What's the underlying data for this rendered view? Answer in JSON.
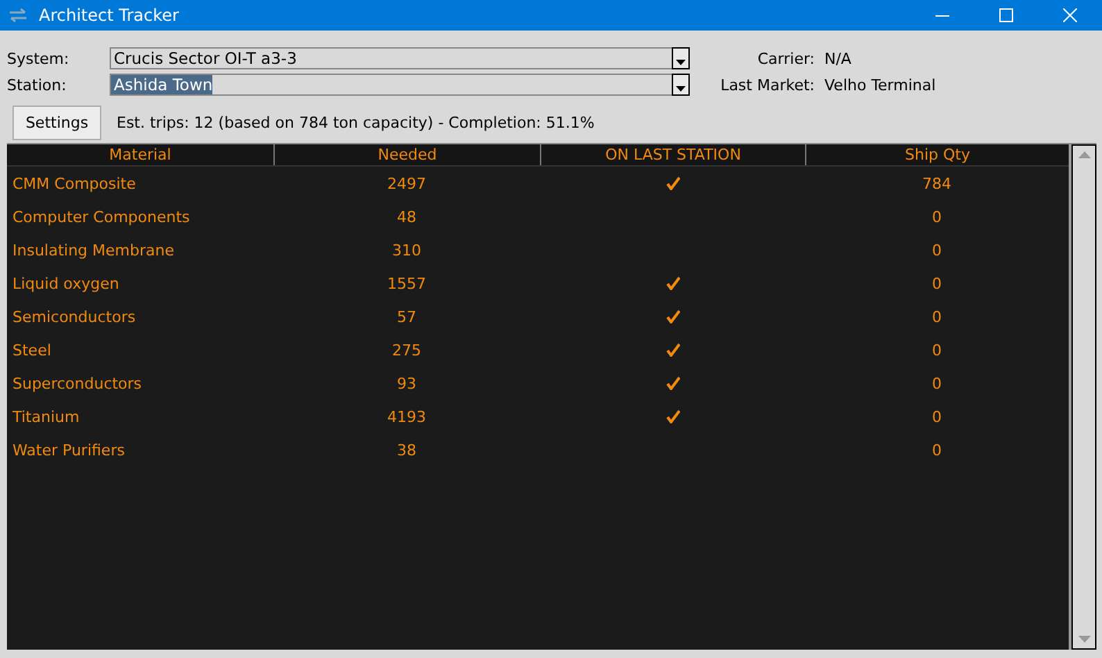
{
  "window": {
    "title": "Architect Tracker"
  },
  "system": {
    "label": "System:",
    "value": "Crucis Sector OI-T a3-3"
  },
  "station": {
    "label": "Station:",
    "value": "Ashida Town"
  },
  "carrier": {
    "label": "Carrier:",
    "value": "N/A"
  },
  "last_market": {
    "label": "Last Market:",
    "value": "Velho Terminal"
  },
  "settings_button": "Settings",
  "summary": "Est. trips: 12 (based on 784 ton capacity) - Completion: 51.1%",
  "table": {
    "columns": [
      "Material",
      "Needed",
      "ON LAST STATION",
      "Ship Qty"
    ],
    "rows": [
      {
        "material": "CMM Composite",
        "needed": "2497",
        "on_last_station": true,
        "ship_qty": "784"
      },
      {
        "material": "Computer Components",
        "needed": "48",
        "on_last_station": false,
        "ship_qty": "0"
      },
      {
        "material": "Insulating Membrane",
        "needed": "310",
        "on_last_station": false,
        "ship_qty": "0"
      },
      {
        "material": "Liquid oxygen",
        "needed": "1557",
        "on_last_station": true,
        "ship_qty": "0"
      },
      {
        "material": "Semiconductors",
        "needed": "57",
        "on_last_station": true,
        "ship_qty": "0"
      },
      {
        "material": "Steel",
        "needed": "275",
        "on_last_station": true,
        "ship_qty": "0"
      },
      {
        "material": "Superconductors",
        "needed": "93",
        "on_last_station": true,
        "ship_qty": "0"
      },
      {
        "material": "Titanium",
        "needed": "4193",
        "on_last_station": true,
        "ship_qty": "0"
      },
      {
        "material": "Water Purifiers",
        "needed": "38",
        "on_last_station": false,
        "ship_qty": "0"
      }
    ]
  }
}
